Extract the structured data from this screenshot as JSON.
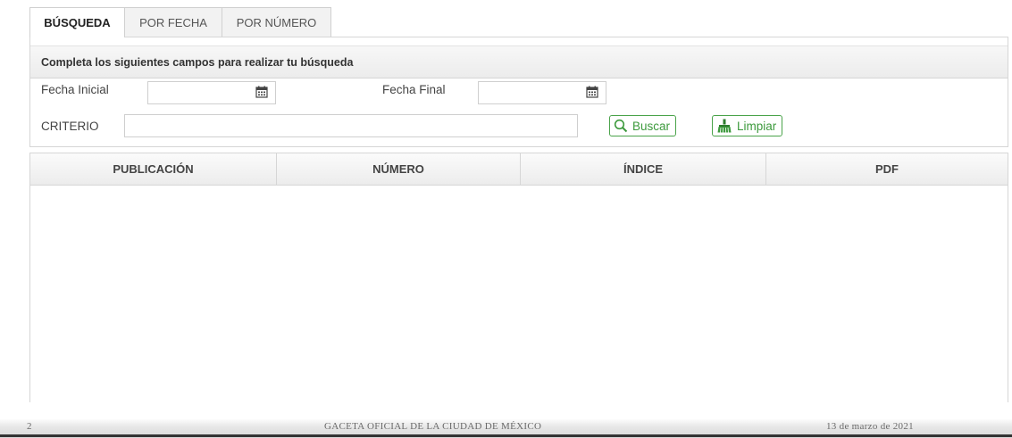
{
  "tabs": [
    {
      "label": "BÚSQUEDA",
      "active": true
    },
    {
      "label": "POR FECHA",
      "active": false
    },
    {
      "label": "POR NÚMERO",
      "active": false
    }
  ],
  "search_panel": {
    "header": "Completa los siguientes campos para realizar tu búsqueda",
    "fecha_inicial_label": "Fecha Inicial",
    "fecha_inicial_value": "",
    "fecha_final_label": "Fecha Final",
    "fecha_final_value": "",
    "criterio_label": "CRITERIO",
    "criterio_value": "",
    "buscar_label": "Buscar",
    "limpiar_label": "Limpiar"
  },
  "results_table": {
    "columns": [
      "PUBLICACIÓN",
      "NÚMERO",
      "ÍNDICE",
      "PDF"
    ],
    "rows": []
  },
  "document_footer": {
    "page_number": "2",
    "title": "GACETA OFICIAL DE LA CIUDAD DE MÉXICO",
    "date": "13 de marzo de 2021"
  },
  "colors": {
    "accent_green": "#3d9a3d",
    "border_gray": "#d6d6d6"
  },
  "icons": {
    "calendar": "calendar-icon",
    "search": "search-icon",
    "clear": "broom-icon"
  }
}
